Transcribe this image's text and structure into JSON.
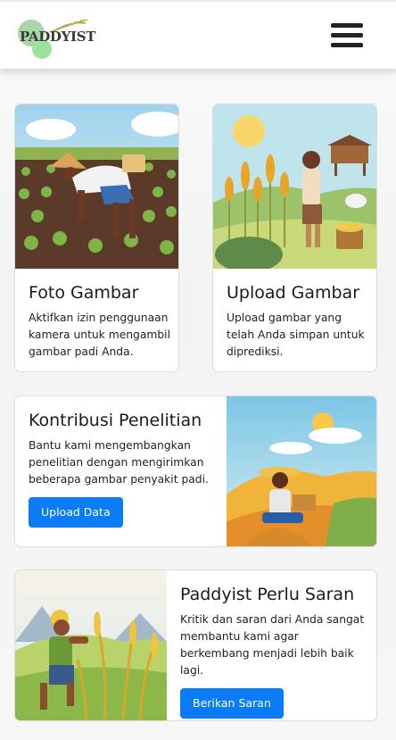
{
  "brand": {
    "name": "PADDYIST"
  },
  "cards": {
    "foto": {
      "title": "Foto Gambar",
      "text": "Aktifkan izin penggunaan kamera untuk mengambil gambar padi Anda."
    },
    "upload": {
      "title": "Upload Gambar",
      "text": "Upload gambar yang telah Anda simpan untuk diprediksi."
    },
    "kontribusi": {
      "title": "Kontribusi Penelitian",
      "text": "Bantu kami mengembangkan penelitian dengan mengirimkan beberapa gambar penyakit padi.",
      "button": "Upload Data"
    },
    "saran": {
      "title": "Paddyist Perlu Saran",
      "text": "Kritik dan saran dari Anda sangat membantu kami agar berkembang menjadi lebih baik lagi.",
      "button": "Berikan Saran"
    }
  },
  "colors": {
    "primary_button": "#0a7cf7",
    "navbar_bg": "#ffffff"
  },
  "icons": [
    "hamburger-menu-icon"
  ]
}
